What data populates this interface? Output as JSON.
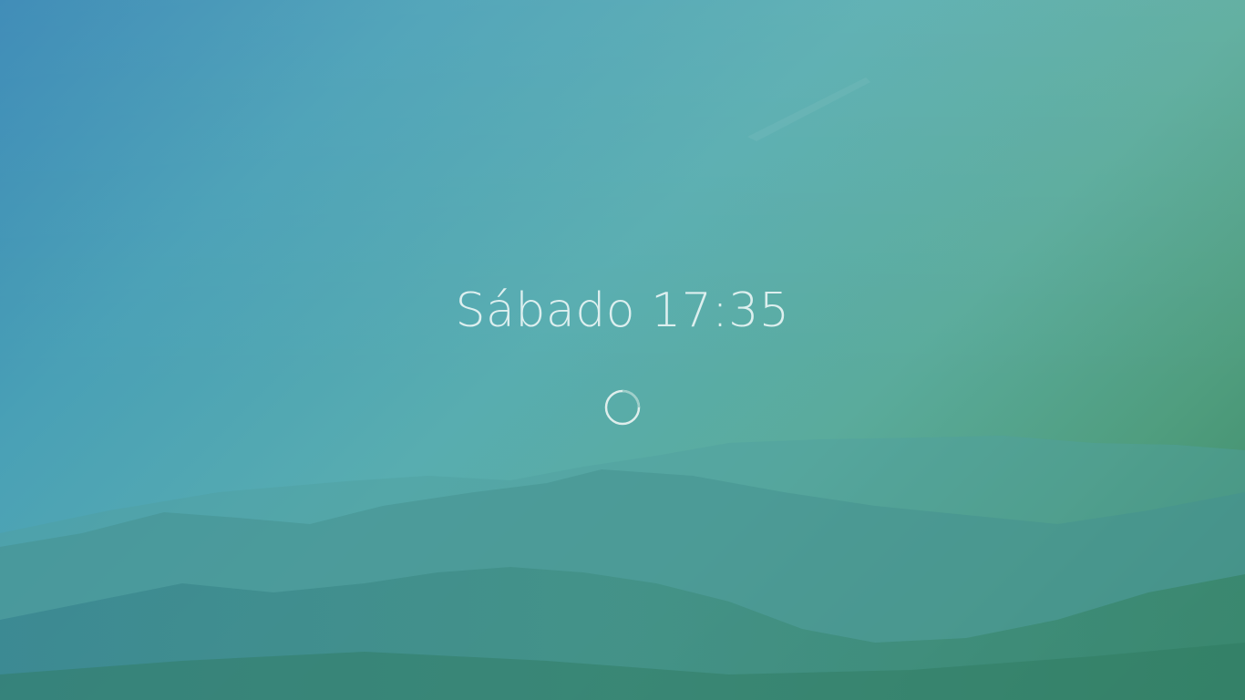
{
  "lockscreen": {
    "clock_text": "Sábado 17:35"
  },
  "icons": {
    "busy_indicator": "loading-spinner-icon"
  },
  "colors": {
    "sky_top_left": "#3586b4",
    "sky_center": "#58adb0",
    "land_bottom_right": "#3a8662",
    "clock_text": "#e8f4f4"
  }
}
